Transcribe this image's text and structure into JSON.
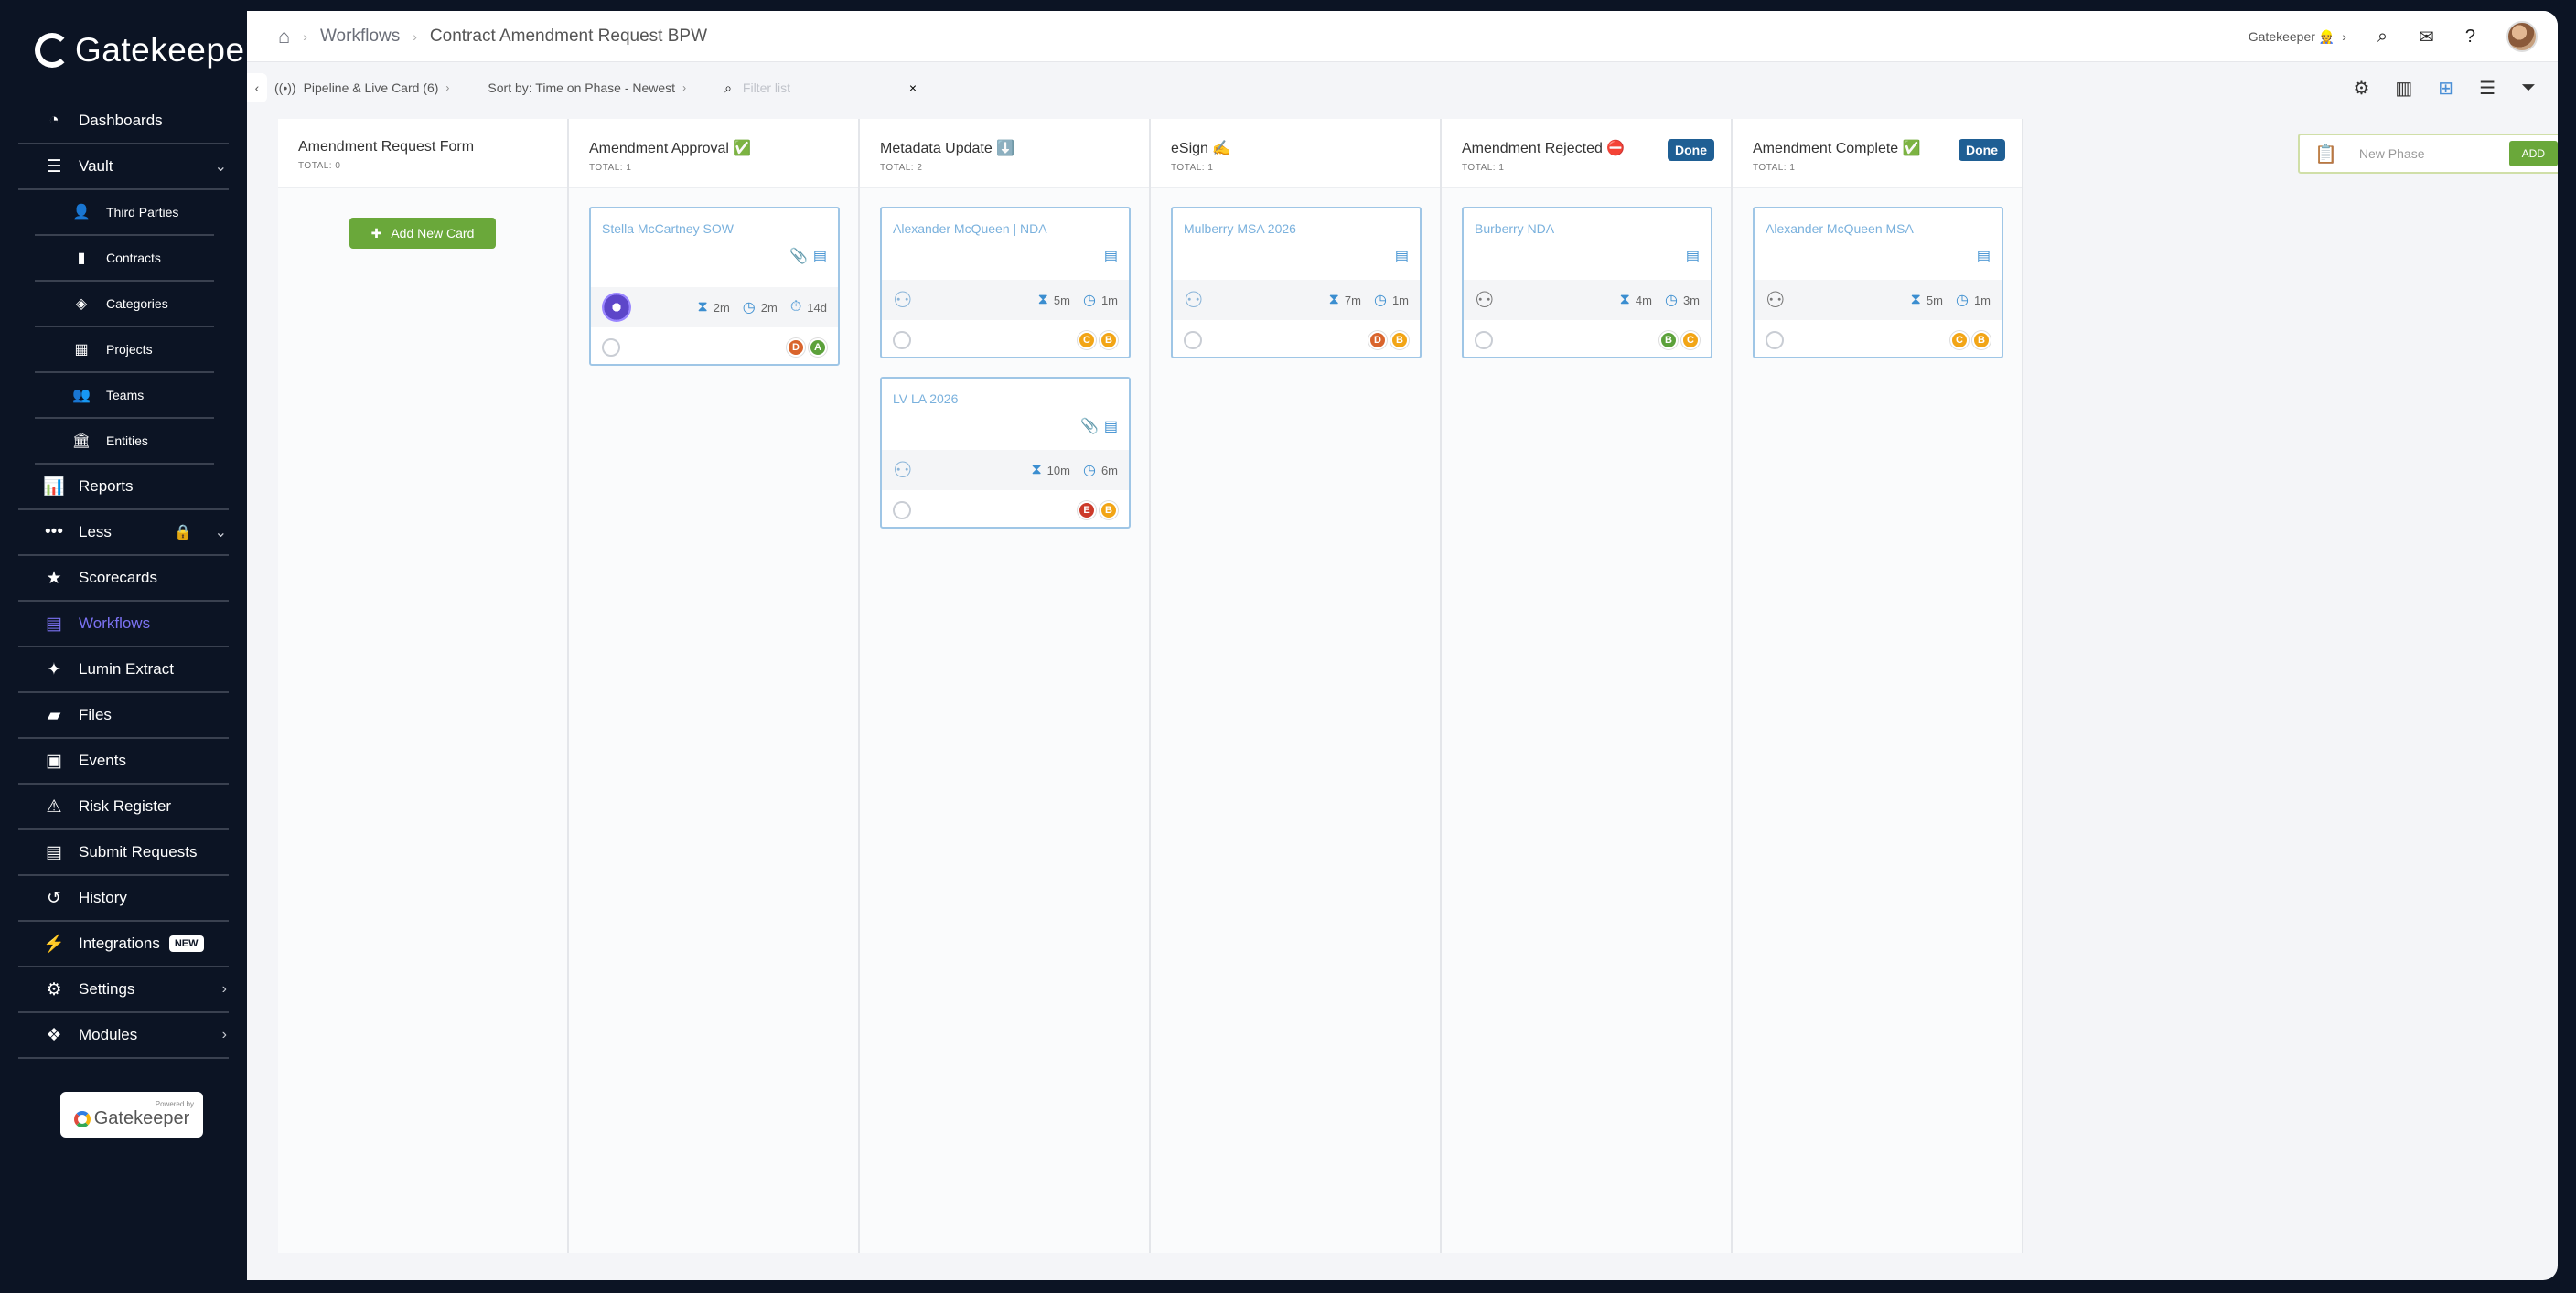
{
  "app": {
    "brand": "Gatekeeper",
    "powered_by": "Powered by",
    "powered_brand": "Gatekeeper"
  },
  "sidebar": {
    "items": [
      {
        "label": "Dashboards",
        "icon": "dashboard-icon",
        "glyph": "◔"
      },
      {
        "label": "Vault",
        "icon": "vault-icon",
        "glyph": "☰",
        "chevron": "⌄"
      },
      {
        "label": "Third Parties",
        "icon": "third-parties-icon",
        "glyph": "👤",
        "sub": true
      },
      {
        "label": "Contracts",
        "icon": "contracts-icon",
        "glyph": "▮",
        "sub": true
      },
      {
        "label": "Categories",
        "icon": "categories-icon",
        "glyph": "◈",
        "sub": true
      },
      {
        "label": "Projects",
        "icon": "projects-icon",
        "glyph": "▦",
        "sub": true
      },
      {
        "label": "Teams",
        "icon": "teams-icon",
        "glyph": "👥",
        "sub": true
      },
      {
        "label": "Entities",
        "icon": "entities-icon",
        "glyph": "🏛",
        "sub": true
      },
      {
        "label": "Reports",
        "icon": "reports-icon",
        "glyph": "📊"
      },
      {
        "label": "Less",
        "icon": "more-dots-icon",
        "glyph": "•••",
        "chevron": "⌄"
      },
      {
        "label": "Scorecards",
        "icon": "scorecards-icon",
        "glyph": "★"
      },
      {
        "label": "Workflows",
        "icon": "workflows-icon",
        "glyph": "▤",
        "active": true
      },
      {
        "label": "Lumin Extract",
        "icon": "sparkle-icon",
        "glyph": "✦"
      },
      {
        "label": "Files",
        "icon": "files-icon",
        "glyph": "▰"
      },
      {
        "label": "Events",
        "icon": "events-icon",
        "glyph": "▣"
      },
      {
        "label": "Risk Register",
        "icon": "warning-icon",
        "glyph": "⚠"
      },
      {
        "label": "Submit Requests",
        "icon": "submit-requests-icon",
        "glyph": "▤"
      },
      {
        "label": "History",
        "icon": "history-icon",
        "glyph": "↺"
      },
      {
        "label": "Integrations",
        "icon": "plug-icon",
        "glyph": "⚡",
        "badge": "NEW"
      },
      {
        "label": "Settings",
        "icon": "gear-icon",
        "glyph": "⚙",
        "chevron": "›"
      },
      {
        "label": "Modules",
        "icon": "modules-icon",
        "glyph": "❖",
        "chevron": "›"
      }
    ]
  },
  "header": {
    "breadcrumb": [
      "Workflows",
      "Contract Amendment Request BPW"
    ],
    "org_label": "Gatekeeper 👷",
    "icons": [
      "search-icon",
      "mail-icon",
      "help-icon"
    ]
  },
  "toolbar": {
    "pipeline": "Pipeline & Live Card (6)",
    "sort": "Sort by: Time on Phase - Newest",
    "filter_placeholder": "Filter list",
    "clear": "×"
  },
  "columns": [
    {
      "title": "Amendment Request Form",
      "total": "TOTAL: 0",
      "add_label": "Add New Card",
      "cards": []
    },
    {
      "title": "Amendment Approval ✅",
      "total": "TOTAL: 1",
      "cards": [
        {
          "name": "Stella McCartney SOW",
          "icons": [
            "📎",
            "▤"
          ],
          "assignee": "ai",
          "times": [
            "2m",
            "2m",
            "14d"
          ],
          "avatars": [
            {
              "l": "D",
              "c": "#d9642c"
            },
            {
              "l": "A",
              "c": "#5ca13b"
            }
          ]
        }
      ]
    },
    {
      "title": "Metadata Update ⬇️",
      "total": "TOTAL: 2",
      "cards": [
        {
          "name": "Alexander McQueen | NDA",
          "icons": [
            "▤"
          ],
          "assignee": "group",
          "times": [
            "5m",
            "1m"
          ],
          "avatars": [
            {
              "l": "C",
              "c": "#f2a516"
            },
            {
              "l": "B",
              "c": "#f2a516"
            }
          ]
        },
        {
          "name": "LV LA 2026",
          "icons": [
            "📎",
            "▤"
          ],
          "assignee": "group",
          "times": [
            "10m",
            "6m"
          ],
          "avatars": [
            {
              "l": "E",
              "c": "#cc3a2a"
            },
            {
              "l": "B",
              "c": "#f2a516"
            }
          ]
        }
      ]
    },
    {
      "title": "eSign ✍️",
      "total": "TOTAL: 1",
      "cards": [
        {
          "name": "Mulberry MSA 2026",
          "icons": [
            "▤"
          ],
          "assignee": "group",
          "times": [
            "7m",
            "1m"
          ],
          "avatars": [
            {
              "l": "D",
              "c": "#d9642c"
            },
            {
              "l": "B",
              "c": "#f2a516"
            }
          ]
        }
      ]
    },
    {
      "title": "Amendment Rejected ⛔",
      "total": "TOTAL: 1",
      "done": "Done",
      "cards": [
        {
          "name": "Burberry NDA",
          "icons": [
            "▤"
          ],
          "assignee": "group-gray",
          "times": [
            "4m",
            "3m"
          ],
          "avatars": [
            {
              "l": "B",
              "c": "#5ca13b"
            },
            {
              "l": "C",
              "c": "#f2a516"
            }
          ]
        }
      ]
    },
    {
      "title": "Amendment Complete ✅",
      "total": "TOTAL: 1",
      "done": "Done",
      "cards": [
        {
          "name": "Alexander McQueen MSA",
          "icons": [
            "▤"
          ],
          "assignee": "group-gray",
          "times": [
            "5m",
            "1m"
          ],
          "avatars": [
            {
              "l": "C",
              "c": "#f2a516"
            },
            {
              "l": "B",
              "c": "#f2a516"
            }
          ]
        }
      ]
    }
  ],
  "new_phase": {
    "placeholder": "New Phase",
    "add_label": "ADD"
  }
}
